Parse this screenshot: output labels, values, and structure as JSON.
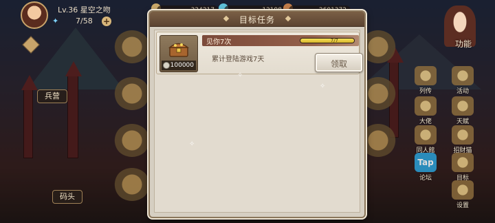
{
  "player": {
    "level_label": "Lv.36 星空之吻",
    "energy": "7/58"
  },
  "resources": [
    {
      "amount": "324217"
    },
    {
      "amount": "12198"
    },
    {
      "amount": "2601372"
    }
  ],
  "left_menu": {
    "labels": [
      "兵营",
      "码头"
    ]
  },
  "right_menu": {
    "function_label": "功能",
    "items": [
      {
        "label": "列传",
        "icon": "book-icon"
      },
      {
        "label": "活动",
        "icon": "medal-icon"
      },
      {
        "label": "大佬",
        "icon": "crown-icon"
      },
      {
        "label": "天赋",
        "icon": "shield-icon"
      },
      {
        "label": "同人館",
        "icon": "castle-icon"
      },
      {
        "label": "招财猫",
        "icon": "cat-icon"
      },
      {
        "label": "论坛",
        "icon": "tap-icon",
        "badge": "Tap"
      },
      {
        "label": "目标",
        "icon": "target-icon"
      },
      {
        "label": "设置",
        "icon": "gear-icon"
      }
    ]
  },
  "modal": {
    "title": "目标任务",
    "task": {
      "name": "见你7次",
      "progress_text": "7/7",
      "progress_fraction": 1.0,
      "description": "累计登陆游戏7天",
      "reward_count": "100000",
      "reward_icon": "treasure-chest-icon",
      "claim_label": "领取"
    }
  },
  "colors": {
    "modal_bg": "#d6cfc2",
    "header_bg": "#6b503b",
    "progress_fill": "#e8cc3c",
    "name_bar": "#7b4a3a"
  }
}
